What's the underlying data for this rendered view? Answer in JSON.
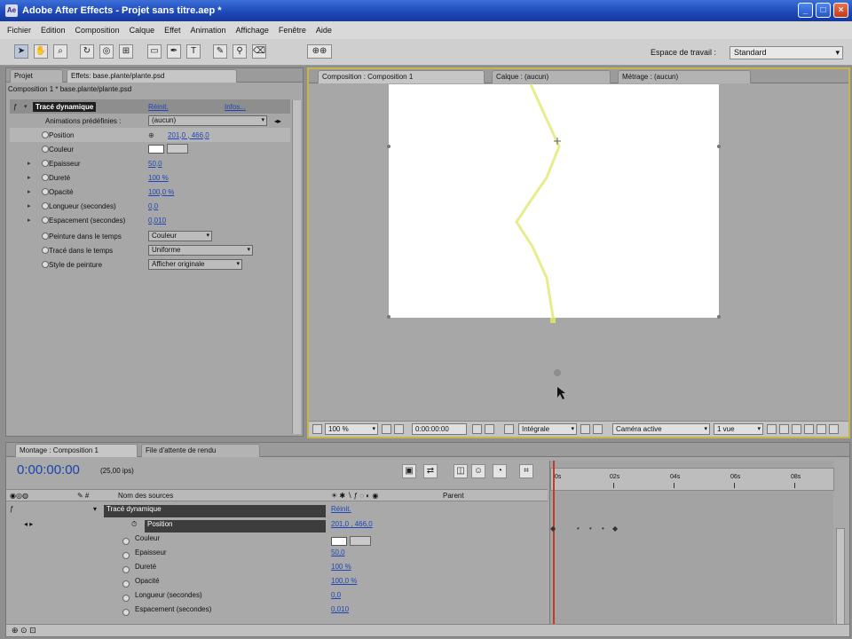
{
  "window": {
    "title": "Adobe After Effects - Projet sans titre.aep *",
    "min": "_",
    "max": "□",
    "close": "×"
  },
  "menu": [
    "Fichier",
    "Edition",
    "Composition",
    "Calque",
    "Effet",
    "Animation",
    "Affichage",
    "Fenêtre",
    "Aide"
  ],
  "toolbar": {
    "workspace_label": "Espace de travail :",
    "workspace_value": "Standard"
  },
  "left_panel": {
    "tabs": [
      "Projet",
      "Effets: base.plante/plante.psd"
    ],
    "header": "Composition 1 * base.plante/plante.psd",
    "effect": {
      "name": "Tracé dynamique",
      "reset": "Réinit.",
      "about": "Infos..."
    },
    "preset": {
      "label": "Animations prédéfinies :",
      "value": "(aucun)"
    },
    "props": [
      {
        "name": "Position",
        "value": "201,0 , 466,0"
      },
      {
        "name": "Couleur",
        "value": ""
      },
      {
        "name": "Epaisseur",
        "value": "50,0"
      },
      {
        "name": "Dureté",
        "value": "100 %"
      },
      {
        "name": "Opacité",
        "value": "100,0 %"
      },
      {
        "name": "Longueur (secondes)",
        "value": "0,0"
      },
      {
        "name": "Espacement (secondes)",
        "value": "0,010"
      }
    ],
    "dropdowns": [
      {
        "name": "Peinture dans le temps",
        "value": "Couleur"
      },
      {
        "name": "Tracé dans le temps",
        "value": "Uniforme"
      },
      {
        "name": "Style de peinture",
        "value": "Afficher originale"
      }
    ]
  },
  "comp_panel": {
    "tabs": [
      "Composition : Composition 1",
      "Calque : (aucun)",
      "Métrage : (aucun)"
    ],
    "zoom": "100 %",
    "timecode": "0:00:00:00",
    "resolution": "Intégrale",
    "camera": "Caméra active",
    "views": "1 vue"
  },
  "timeline": {
    "tabs": [
      "Montage : Composition 1",
      "File d'attente de rendu"
    ],
    "time": "0:00:00:00",
    "fps": "(25,00 ips)",
    "col_source": "Nom des sources",
    "col_parent": "Parent",
    "effect_name": "Tracé dynamique",
    "effect_reset": "Réinit.",
    "rows": [
      {
        "name": "Position",
        "value": "201,0 , 466,0"
      },
      {
        "name": "Couleur",
        "value": ""
      },
      {
        "name": "Epaisseur",
        "value": "50,0"
      },
      {
        "name": "Dureté",
        "value": "100 %"
      },
      {
        "name": "Opacité",
        "value": "100,0 %"
      },
      {
        "name": "Longueur (secondes)",
        "value": "0,0"
      },
      {
        "name": "Espacement (secondes)",
        "value": "0,010"
      }
    ],
    "ruler": [
      "0s",
      "02s",
      "04s",
      "06s",
      "08s"
    ]
  },
  "colors": {
    "stroke": "#e8ec8e",
    "panel_border": "#c9b44a",
    "link": "#1d47b8"
  }
}
